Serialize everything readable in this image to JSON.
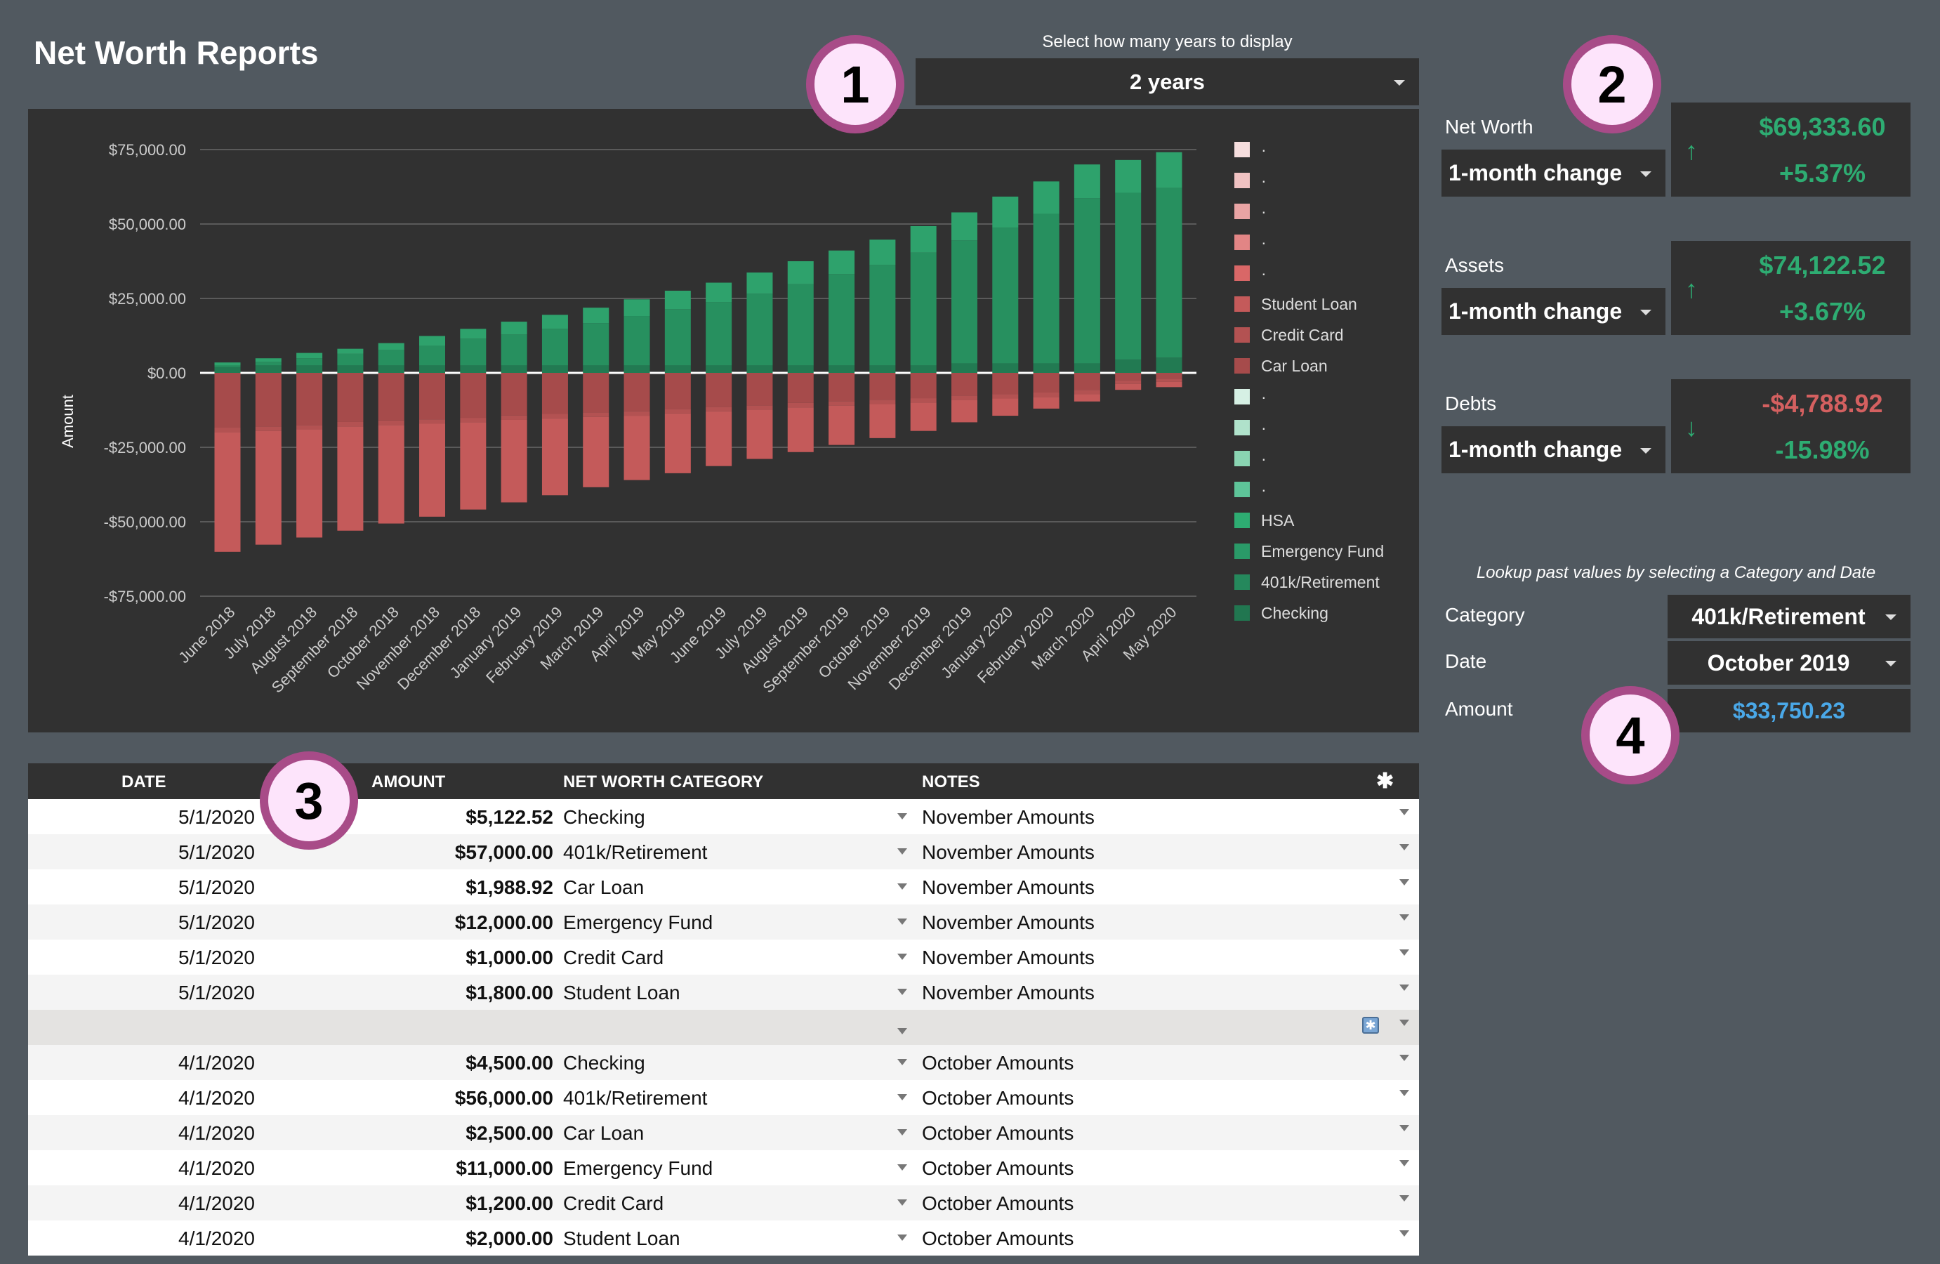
{
  "title": "Net Worth Reports",
  "years_selector": {
    "label": "Select how many years to display",
    "value": "2 years"
  },
  "markers": [
    "1",
    "2",
    "3",
    "4"
  ],
  "summary": [
    {
      "label": "Net Worth",
      "period": "1-month change",
      "value": "$69,333.60",
      "change": "+5.37%",
      "direction": "up",
      "value_color": "#2eac72",
      "change_color": "#2eac72",
      "arrow": "↑"
    },
    {
      "label": "Assets",
      "period": "1-month change",
      "value": "$74,122.52",
      "change": "+3.67%",
      "direction": "up",
      "value_color": "#2eac72",
      "change_color": "#2eac72",
      "arrow": "↑"
    },
    {
      "label": "Debts",
      "period": "1-month change",
      "value": "-$4,788.92",
      "change": "-15.98%",
      "direction": "down",
      "value_color": "#d46060",
      "change_color": "#2eac72",
      "arrow": "↓"
    }
  ],
  "lookup": {
    "label": "Lookup past values by selecting a Category and Date",
    "category_label": "Category",
    "category": "401k/Retirement",
    "date_label": "Date",
    "date": "October 2019",
    "amount_label": "Amount",
    "amount": "$33,750.23",
    "amount_color": "#4aa8e8"
  },
  "chart_data": {
    "type": "bar",
    "stacked": true,
    "ylabel": "Amount",
    "ylim": [
      -75000,
      75000
    ],
    "yticks": [
      "$75,000.00",
      "$50,000.00",
      "$25,000.00",
      "$0.00",
      "-$25,000.00",
      "-$50,000.00",
      "-$75,000.00"
    ],
    "ytick_values": [
      75000,
      50000,
      25000,
      0,
      -25000,
      -50000,
      -75000
    ],
    "grid": true,
    "legend_position": "right",
    "categories": [
      "June 2018",
      "July 2018",
      "August 2018",
      "September 2018",
      "October 2018",
      "November 2018",
      "December 2018",
      "January 2019",
      "February 2019",
      "March 2019",
      "April 2019",
      "May 2019",
      "June 2019",
      "July 2019",
      "August 2019",
      "September 2019",
      "October 2019",
      "November 2019",
      "December 2019",
      "January 2020",
      "February 2020",
      "March 2020",
      "April 2020",
      "May 2020"
    ],
    "series": [
      {
        "name": "Checking",
        "color": "#227a52",
        "values": [
          2000,
          2500,
          2500,
          2500,
          2500,
          2500,
          2500,
          2500,
          2500,
          2500,
          2500,
          2500,
          2500,
          2500,
          2500,
          2500,
          2500,
          2500,
          3200,
          3200,
          3200,
          3200,
          4500,
          5122.52
        ]
      },
      {
        "name": "401k/Retirement",
        "color": "#27905f",
        "values": [
          500,
          1200,
          2400,
          3900,
          5200,
          6600,
          9000,
          10400,
          12300,
          14200,
          16600,
          18900,
          21300,
          24100,
          27300,
          30700,
          33750.23,
          37900,
          41300,
          45600,
          50200,
          55500,
          56000,
          57000
        ]
      },
      {
        "name": "Emergency Fund",
        "color": "#2ea26c",
        "values": [
          1000,
          1200,
          1800,
          1700,
          2300,
          3300,
          3300,
          4300,
          4700,
          5200,
          5600,
          6200,
          6500,
          7100,
          7700,
          7900,
          8500,
          8900,
          9400,
          10400,
          10900,
          11300,
          11000,
          12000
        ]
      },
      {
        "name": "Car Loan",
        "color": "#a64b4b",
        "values": [
          -18400,
          -18000,
          -17500,
          -16500,
          -16000,
          -15600,
          -15100,
          -14300,
          -13800,
          -13300,
          -12900,
          -12100,
          -11400,
          -10900,
          -10100,
          -9500,
          -9000,
          -8500,
          -7600,
          -7100,
          -6600,
          -5700,
          -2500,
          -1988.92
        ]
      },
      {
        "name": "Credit Card",
        "color": "#b35252",
        "values": [
          -1500,
          -1500,
          -1500,
          -1500,
          -1500,
          -1500,
          -1500,
          -1500,
          -1500,
          -1500,
          -1500,
          -1500,
          -1500,
          -1500,
          -1500,
          -1500,
          -1500,
          -1500,
          -1500,
          -1500,
          -1500,
          -1500,
          -1200,
          -1000
        ]
      },
      {
        "name": "Student Loan",
        "color": "#c45a5a",
        "values": [
          -40200,
          -38200,
          -36300,
          -35000,
          -33100,
          -31200,
          -29300,
          -27700,
          -25800,
          -23600,
          -21600,
          -20100,
          -18400,
          -16500,
          -15000,
          -13200,
          -11400,
          -9500,
          -7500,
          -5800,
          -3900,
          -2400,
          -2000,
          -1800
        ]
      }
    ],
    "legend": [
      {
        "label": "·",
        "color": "#f6dede"
      },
      {
        "label": "·",
        "color": "#f0c2c2"
      },
      {
        "label": "·",
        "color": "#e9a4a4"
      },
      {
        "label": "·",
        "color": "#e28585"
      },
      {
        "label": "·",
        "color": "#d96767"
      },
      {
        "label": "Student Loan",
        "color": "#c45a5a"
      },
      {
        "label": "Credit Card",
        "color": "#b35252"
      },
      {
        "label": "Car Loan",
        "color": "#a64b4b"
      },
      {
        "label": "·",
        "color": "#d6f0e4"
      },
      {
        "label": "·",
        "color": "#b0e2cb"
      },
      {
        "label": "·",
        "color": "#8ad4b2"
      },
      {
        "label": "·",
        "color": "#5ec499"
      },
      {
        "label": "HSA",
        "color": "#2eac72"
      },
      {
        "label": "Emergency Fund",
        "color": "#2a9a68"
      },
      {
        "label": "401k/Retirement",
        "color": "#25885c"
      },
      {
        "label": "Checking",
        "color": "#217650"
      }
    ]
  },
  "table": {
    "headers": {
      "date": "DATE",
      "amount": "AMOUNT",
      "category": "NET WORTH CATEGORY",
      "notes": "NOTES",
      "add": "✱"
    },
    "rows": [
      {
        "date": "5/1/2020",
        "amount": "$5,122.52",
        "category": "Checking",
        "notes": "November Amounts"
      },
      {
        "date": "5/1/2020",
        "amount": "$57,000.00",
        "category": "401k/Retirement",
        "notes": "November Amounts"
      },
      {
        "date": "5/1/2020",
        "amount": "$1,988.92",
        "category": "Car Loan",
        "notes": "November Amounts"
      },
      {
        "date": "5/1/2020",
        "amount": "$12,000.00",
        "category": "Emergency Fund",
        "notes": "November Amounts"
      },
      {
        "date": "5/1/2020",
        "amount": "$1,000.00",
        "category": "Credit Card",
        "notes": "November Amounts"
      },
      {
        "date": "5/1/2020",
        "amount": "$1,800.00",
        "category": "Student Loan",
        "notes": "November Amounts"
      },
      {
        "date": "",
        "amount": "",
        "category": "",
        "notes": "",
        "empty": true
      },
      {
        "date": "4/1/2020",
        "amount": "$4,500.00",
        "category": "Checking",
        "notes": "October Amounts"
      },
      {
        "date": "4/1/2020",
        "amount": "$56,000.00",
        "category": "401k/Retirement",
        "notes": "October Amounts"
      },
      {
        "date": "4/1/2020",
        "amount": "$2,500.00",
        "category": "Car Loan",
        "notes": "October Amounts"
      },
      {
        "date": "4/1/2020",
        "amount": "$11,000.00",
        "category": "Emergency Fund",
        "notes": "October Amounts"
      },
      {
        "date": "4/1/2020",
        "amount": "$1,200.00",
        "category": "Credit Card",
        "notes": "October Amounts"
      },
      {
        "date": "4/1/2020",
        "amount": "$2,000.00",
        "category": "Student Loan",
        "notes": "October Amounts"
      }
    ]
  }
}
